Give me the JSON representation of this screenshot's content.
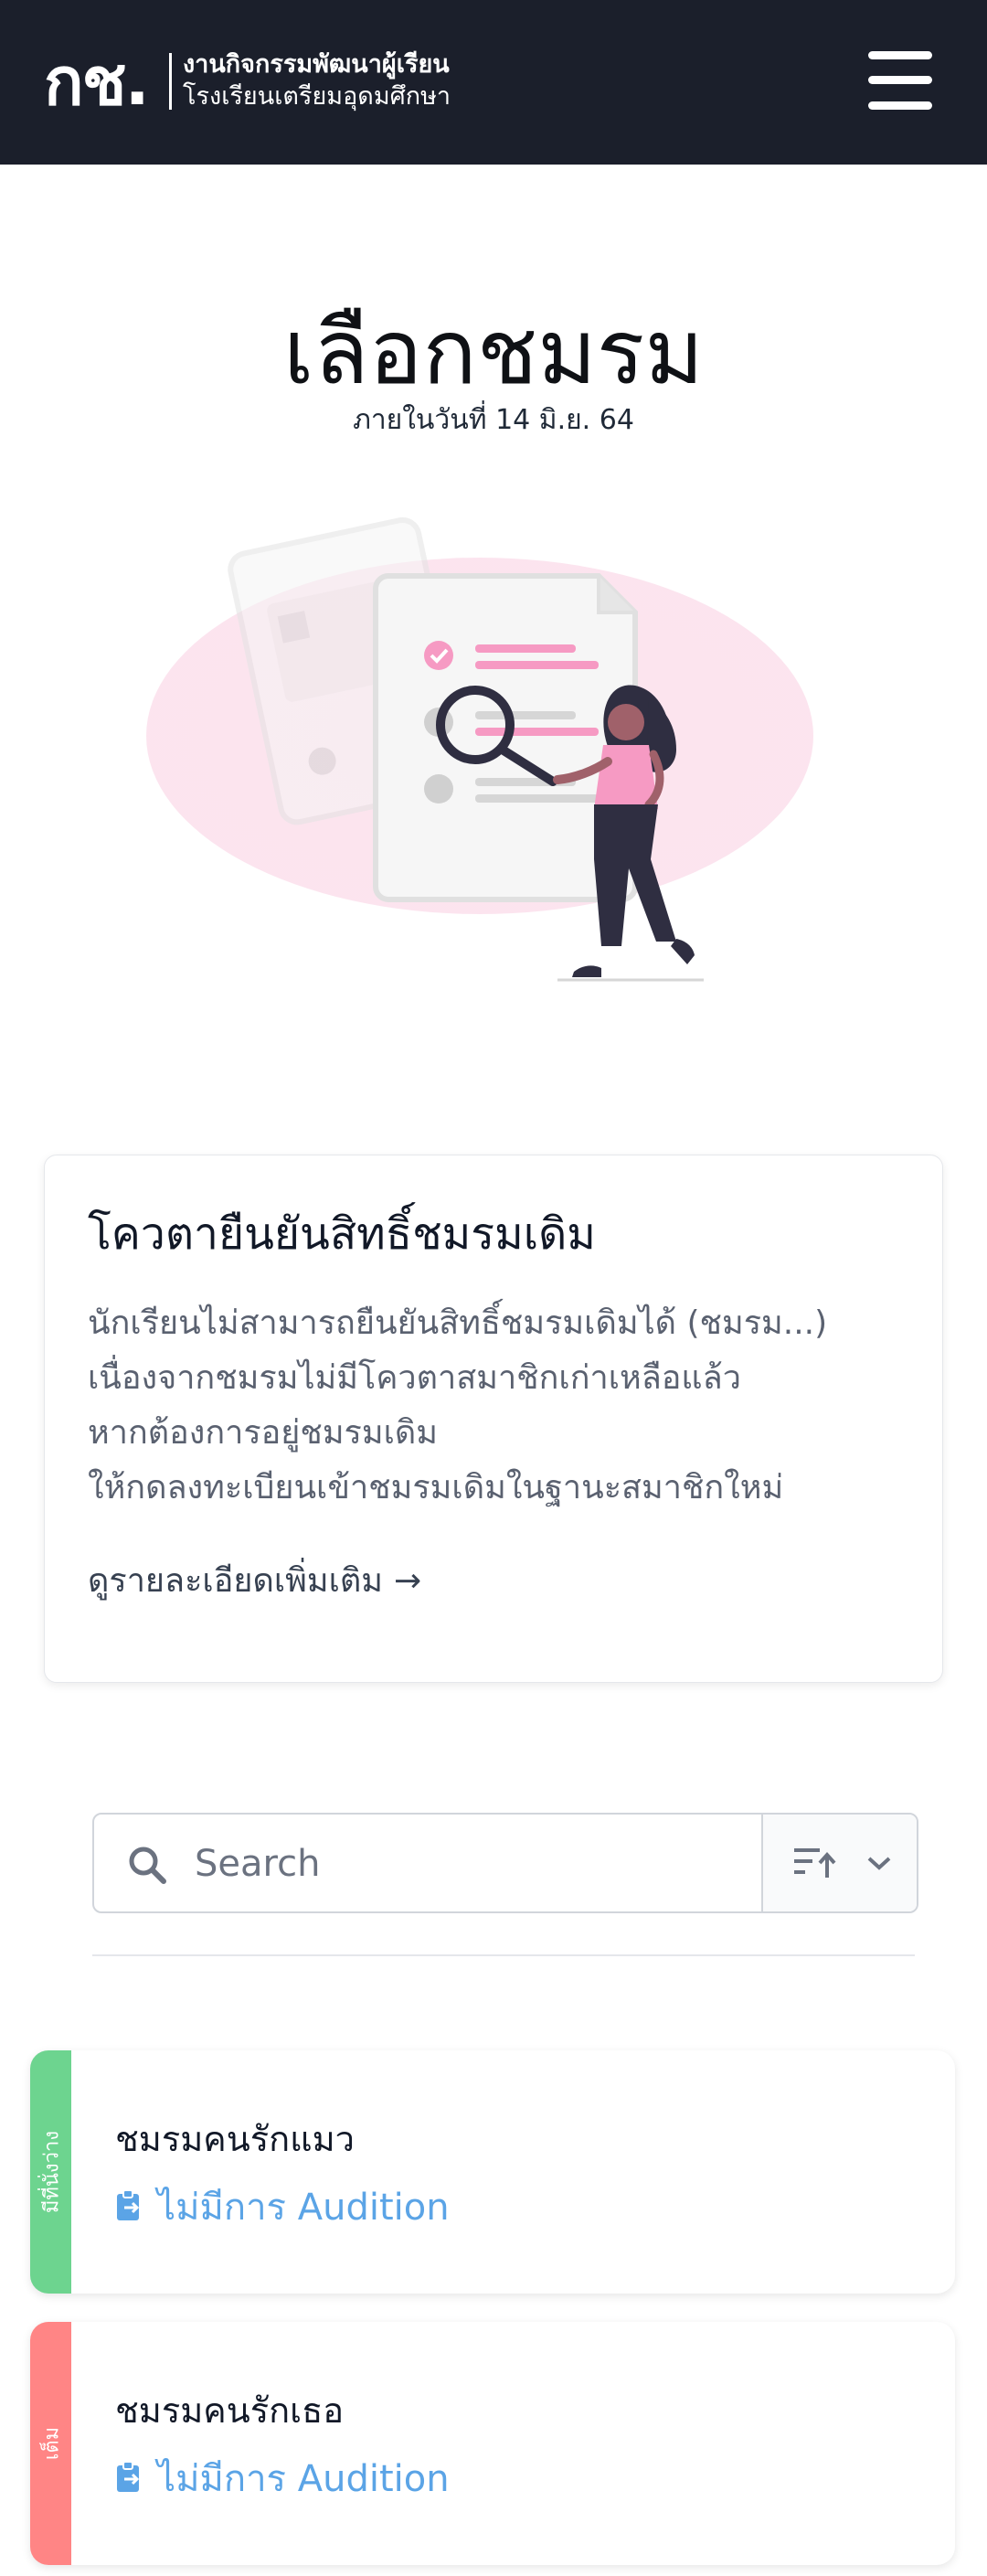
{
  "header": {
    "logo_mark": "กช.",
    "logo_line1": "งานกิจกรรมพัฒนาผู้เรียน",
    "logo_line2": "โรงเรียนเตรียมอุดมศึกษา",
    "menu_icon": "hamburger-menu-icon"
  },
  "page": {
    "title": "เลือกชมรม",
    "subtitle": "ภายในวันที่ 14 มิ.ย. 64"
  },
  "hero": {
    "illustration": "woman-with-magnifier-checklist"
  },
  "notice": {
    "title": "โควตายืนยันสิทธิ์ชมรมเดิม",
    "lines": [
      "นักเรียนไม่สามารถยืนยันสิทธิ์ชมรมเดิมได้ (ชมรม...)",
      "เนื่องจากชมรมไม่มีโควตาสมาชิกเก่าเหลือแล้ว",
      "หากต้องการอยู่ชมรมเดิม",
      "ให้กดลงทะเบียนเข้าชมรมเดิมในฐานะสมาชิกใหม่"
    ],
    "link_label": "ดูรายละเอียดเพิ่มเติม",
    "link_arrow": "→"
  },
  "search": {
    "placeholder": "Search",
    "value": "",
    "search_icon": "search-icon",
    "sort_icon": "sort-ascending-icon",
    "dropdown_icon": "chevron-down-icon"
  },
  "clubs": [
    {
      "status": "มีที่นั่งว่าง",
      "status_color": "#6dd48f",
      "name": "ชมรมคนรักแมว",
      "audition": "ไม่มีการ Audition",
      "audition_icon": "clipboard-arrow-icon"
    },
    {
      "status": "เต็ม",
      "status_color": "#ff8585",
      "name": "ชมรมคนรักเธอ",
      "audition": "ไม่มีการ Audition",
      "audition_icon": "clipboard-arrow-icon"
    }
  ],
  "colors": {
    "header_bg": "#1b1f2b",
    "accent_pink": "#f69ac3",
    "link_blue": "#5ba4e6",
    "available_green": "#6dd48f",
    "full_red": "#ff8585"
  }
}
